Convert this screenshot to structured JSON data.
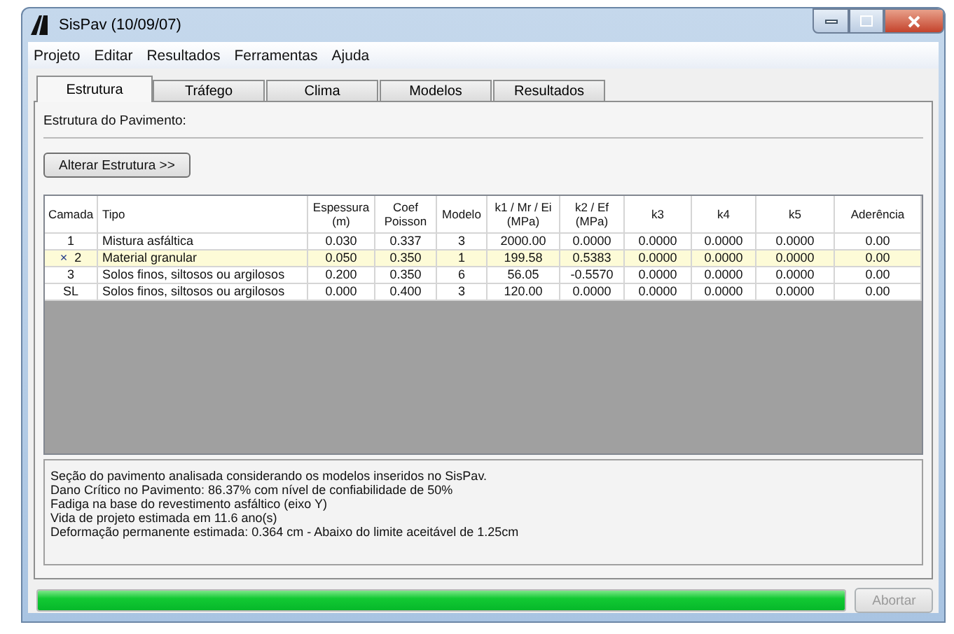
{
  "window": {
    "title": "SisPav (10/09/07)"
  },
  "menu": [
    "Projeto",
    "Editar",
    "Resultados",
    "Ferramentas",
    "Ajuda"
  ],
  "tabs": [
    {
      "label": "Estrutura",
      "selected": true
    },
    {
      "label": "Tráfego",
      "selected": false
    },
    {
      "label": "Clima",
      "selected": false
    },
    {
      "label": "Modelos",
      "selected": false
    },
    {
      "label": "Resultados",
      "selected": false
    }
  ],
  "section_title": "Estrutura do Pavimento:",
  "alter_button": "Alterar Estrutura >>",
  "table": {
    "columns": [
      "Camada",
      "Tipo",
      "Espessura (m)",
      "Coef Poisson",
      "Modelo",
      "k1 / Mr / Ei (MPa)",
      "k2 / Ef (MPa)",
      "k3",
      "k4",
      "k5",
      "Aderência"
    ],
    "rows": [
      {
        "marker": "",
        "selected": false,
        "cells": [
          "1",
          "Mistura asfáltica",
          "0.030",
          "0.337",
          "3",
          "2000.00",
          "0.0000",
          "0.0000",
          "0.0000",
          "0.0000",
          "0.00"
        ]
      },
      {
        "marker": "×",
        "selected": true,
        "cells": [
          "2",
          "Material granular",
          "0.050",
          "0.350",
          "1",
          "199.58",
          "0.5383",
          "0.0000",
          "0.0000",
          "0.0000",
          "0.00"
        ]
      },
      {
        "marker": "",
        "selected": false,
        "cells": [
          "3",
          "Solos finos, siltosos ou argilosos",
          "0.200",
          "0.350",
          "6",
          "56.05",
          "-0.5570",
          "0.0000",
          "0.0000",
          "0.0000",
          "0.00"
        ]
      },
      {
        "marker": "",
        "selected": false,
        "cells": [
          "SL",
          "Solos finos, siltosos ou argilosos",
          "0.000",
          "0.400",
          "3",
          "120.00",
          "0.0000",
          "0.0000",
          "0.0000",
          "0.0000",
          "0.00"
        ]
      }
    ]
  },
  "messages": [
    "Seção do pavimento analisada considerando os modelos inseridos no SisPav.",
    "Dano Crítico no Pavimento: 86.37% com nível de confiabilidade de 50%",
    "Fadiga na base do revestimento asfáltico (eixo Y)",
    "Vida de projeto estimada em 11.6 ano(s)",
    "Deformação permanente estimada: 0.364 cm - Abaixo do limite aceitável de 1.25cm"
  ],
  "progress": {
    "level": 1
  },
  "abort_button": {
    "label": "Abortar",
    "disabled": true
  }
}
